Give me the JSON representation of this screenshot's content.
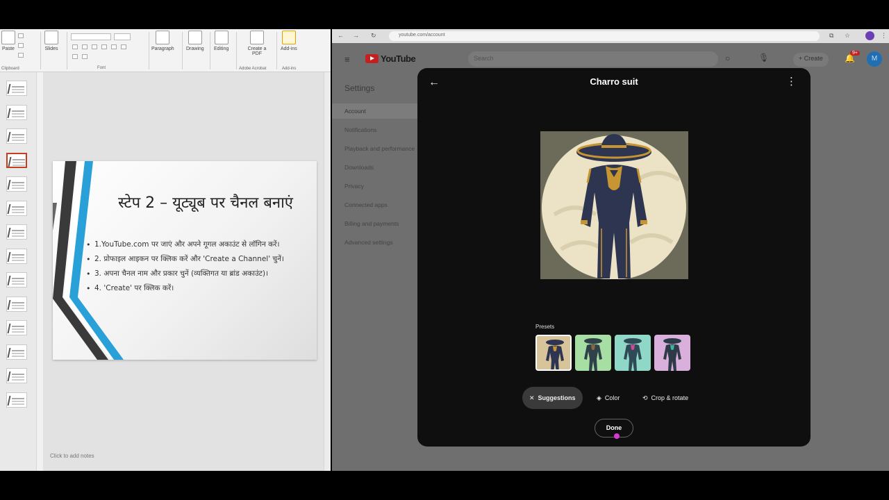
{
  "powerpoint": {
    "ribbon": {
      "paste_label": "Paste",
      "clipboard_group": "Clipboard",
      "slides_label": "Slides",
      "font_group": "Font",
      "paragraph_label": "Paragraph",
      "drawing_label": "Drawing",
      "editing_label": "Editing",
      "create_pdf_label": "Create a PDF",
      "adobe_group": "Adobe Acrobat",
      "addins_label": "Add-ins",
      "addins_group": "Add-ins"
    },
    "slide_count": 14,
    "active_slide": 4,
    "slide": {
      "title": "स्टेप 2 – यूट्यूब पर चैनल बनाएं",
      "bullets": [
        "1.YouTube.com पर जाएं और अपने गूगल अकाउंट से लॉगिन करें।",
        "2. प्रोफाइल आइकन पर क्लिक करें और 'Create a Channel' चुनें।",
        "3. अपना चैनल नाम और प्रकार चुनें (व्यक्तिगत या ब्रांड अकाउंट)।",
        "4. 'Create' पर क्लिक करें।"
      ]
    },
    "notes_placeholder": "Click to add notes"
  },
  "browser": {
    "url": "youtube.com/account",
    "youtube": {
      "logo_text": "YouTube",
      "search_placeholder": "Search",
      "create_label": "Create",
      "notification_count": "9+",
      "avatar_letter": "M"
    },
    "settings": {
      "heading": "Settings",
      "items": [
        "Account",
        "Notifications",
        "Playback and performance",
        "Downloads",
        "Privacy",
        "Connected apps",
        "Billing and payments",
        "Advanced settings"
      ],
      "active_index": 0
    }
  },
  "modal": {
    "title": "Charro suit",
    "presets_label": "Presets",
    "presets": [
      {
        "name": "preset-tan",
        "bg": "#d8c49a",
        "suit": "#2e3550",
        "trim": "#c79531"
      },
      {
        "name": "preset-green",
        "bg": "#a7dea4",
        "suit": "#30414a",
        "trim": "#8a6a3c"
      },
      {
        "name": "preset-teal",
        "bg": "#8fd8c7",
        "suit": "#2e4a55",
        "trim": "#d04a9a"
      },
      {
        "name": "preset-pink",
        "bg": "#d9b0dc",
        "suit": "#2f3a47",
        "trim": "#3fb39d"
      }
    ],
    "selected_preset": 0,
    "tools": {
      "suggestions": "Suggestions",
      "color": "Color",
      "crop": "Crop & rotate"
    },
    "done_label": "Done",
    "colors": {
      "modal_bg": "#0f0f0f",
      "preview_bg": "#6c6a58",
      "moon": "#ece3c6",
      "suit": "#2e3550",
      "trim": "#c79531"
    }
  }
}
